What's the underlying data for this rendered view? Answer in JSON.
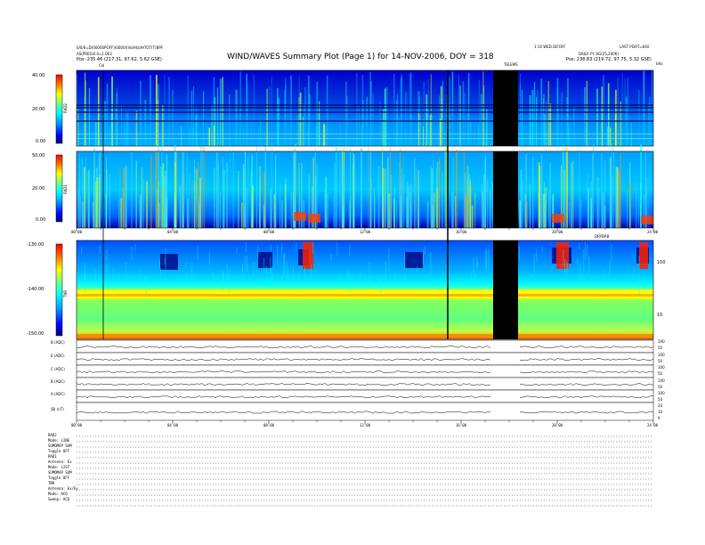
{
  "header": {
    "title": "WIND/WAVES Summary Plot (Page 1) for 14-NOV-2006, DOY = 318",
    "left_line1": "0/0/0=D(0000SPOFF)(0000)(Vol/Hz)/HTOT(T)BPF",
    "left_line2": "AS(PRES)0.0=1.0E3",
    "left_line3": "Pos:  235.46 (217.31, 97.62, 5.62 GSE)",
    "right_line1": "LAST PDOT=640",
    "right_line2": "DAILY: PI: AG(25,2006)",
    "right_line3": "Pos:  238.83 (219.72, 97.75, 5.32 GSE)",
    "center_right": "1:10 WED DIFOFF",
    "gap_label": "TELEMS",
    "freq_unit_top": "kHz",
    "cal_marker": "Cal"
  },
  "panels": {
    "rad2": {
      "label": "RAD2",
      "ticks": [
        "40.00",
        "20.00",
        "0.00"
      ]
    },
    "rad1": {
      "label": "RAD1",
      "ticks": [
        "50.00",
        "20.00",
        "0.00"
      ]
    },
    "tnr": {
      "label": "TNR",
      "ticks": [
        "-130.00",
        "-140.00",
        "-150.00"
      ],
      "right_ticks": [
        "100",
        "10"
      ]
    },
    "mid_time_axis": [
      "00:00",
      "04:00",
      "08:00",
      "12:00",
      "16:00",
      "20:00",
      "24:00"
    ],
    "bottom_time_axis": [
      "00:00",
      "04:00",
      "08:00",
      "12:00",
      "16:00",
      "20:00",
      "24:00"
    ],
    "small_label": "DRYBRB",
    "small_panels": [
      {
        "label": "B (ADC)",
        "right": [
          "100",
          "50"
        ]
      },
      {
        "label": "E (ADC)",
        "right": [
          "100",
          "50"
        ]
      },
      {
        "label": "C (ADC)",
        "right": [
          "100",
          "50"
        ]
      },
      {
        "label": "B (ADC)",
        "right": [
          "100",
          "50"
        ]
      },
      {
        "label": "A (ADC)",
        "right": [
          "100",
          "50"
        ]
      },
      {
        "label": "|B| (nT)",
        "right": [
          "20",
          "10",
          "0"
        ]
      }
    ]
  },
  "footer": {
    "lines": [
      "RAD2",
      "Mode:      LINE",
      "SUMOMAP  SUM",
      "Toggle     OFF",
      "RAD1",
      "Antenna:   Ex",
      "Mode:      LIST",
      "SUMOMAP  SUM",
      "Toggle     OFF",
      "TNR",
      "Antenna:   Ex/Ey",
      "Mode:      ACQ",
      "Sweep:     ACQ"
    ]
  },
  "chart_data": {
    "type": "heatmap",
    "title": "WIND/WAVES Summary Plot (Page 1) for 14-NOV-2006, DOY = 318",
    "xlabel": "",
    "x_ticks": [
      "00:00",
      "04:00",
      "08:00",
      "12:00",
      "16:00",
      "20:00",
      "24:00"
    ],
    "x_range": [
      0,
      24
    ],
    "data_gap_hours": [
      17.3,
      18.0
    ],
    "rad2_intensity_range": [
      0,
      40
    ],
    "rad1_intensity_range": [
      0,
      50
    ],
    "tnr_intensity_range": [
      -150,
      -130
    ],
    "colormap": [
      "#00007f",
      "#0000ff",
      "#0080ff",
      "#00ffff",
      "#80ff80",
      "#ffff00",
      "#ff8000",
      "#ff0000",
      "#7f0000"
    ],
    "colorbars": [
      {
        "panel": "RAD2",
        "min": 0,
        "max": 40
      },
      {
        "panel": "RAD1",
        "min": 0,
        "max": 50
      },
      {
        "panel": "TNR",
        "min": -150,
        "max": -130
      }
    ]
  }
}
